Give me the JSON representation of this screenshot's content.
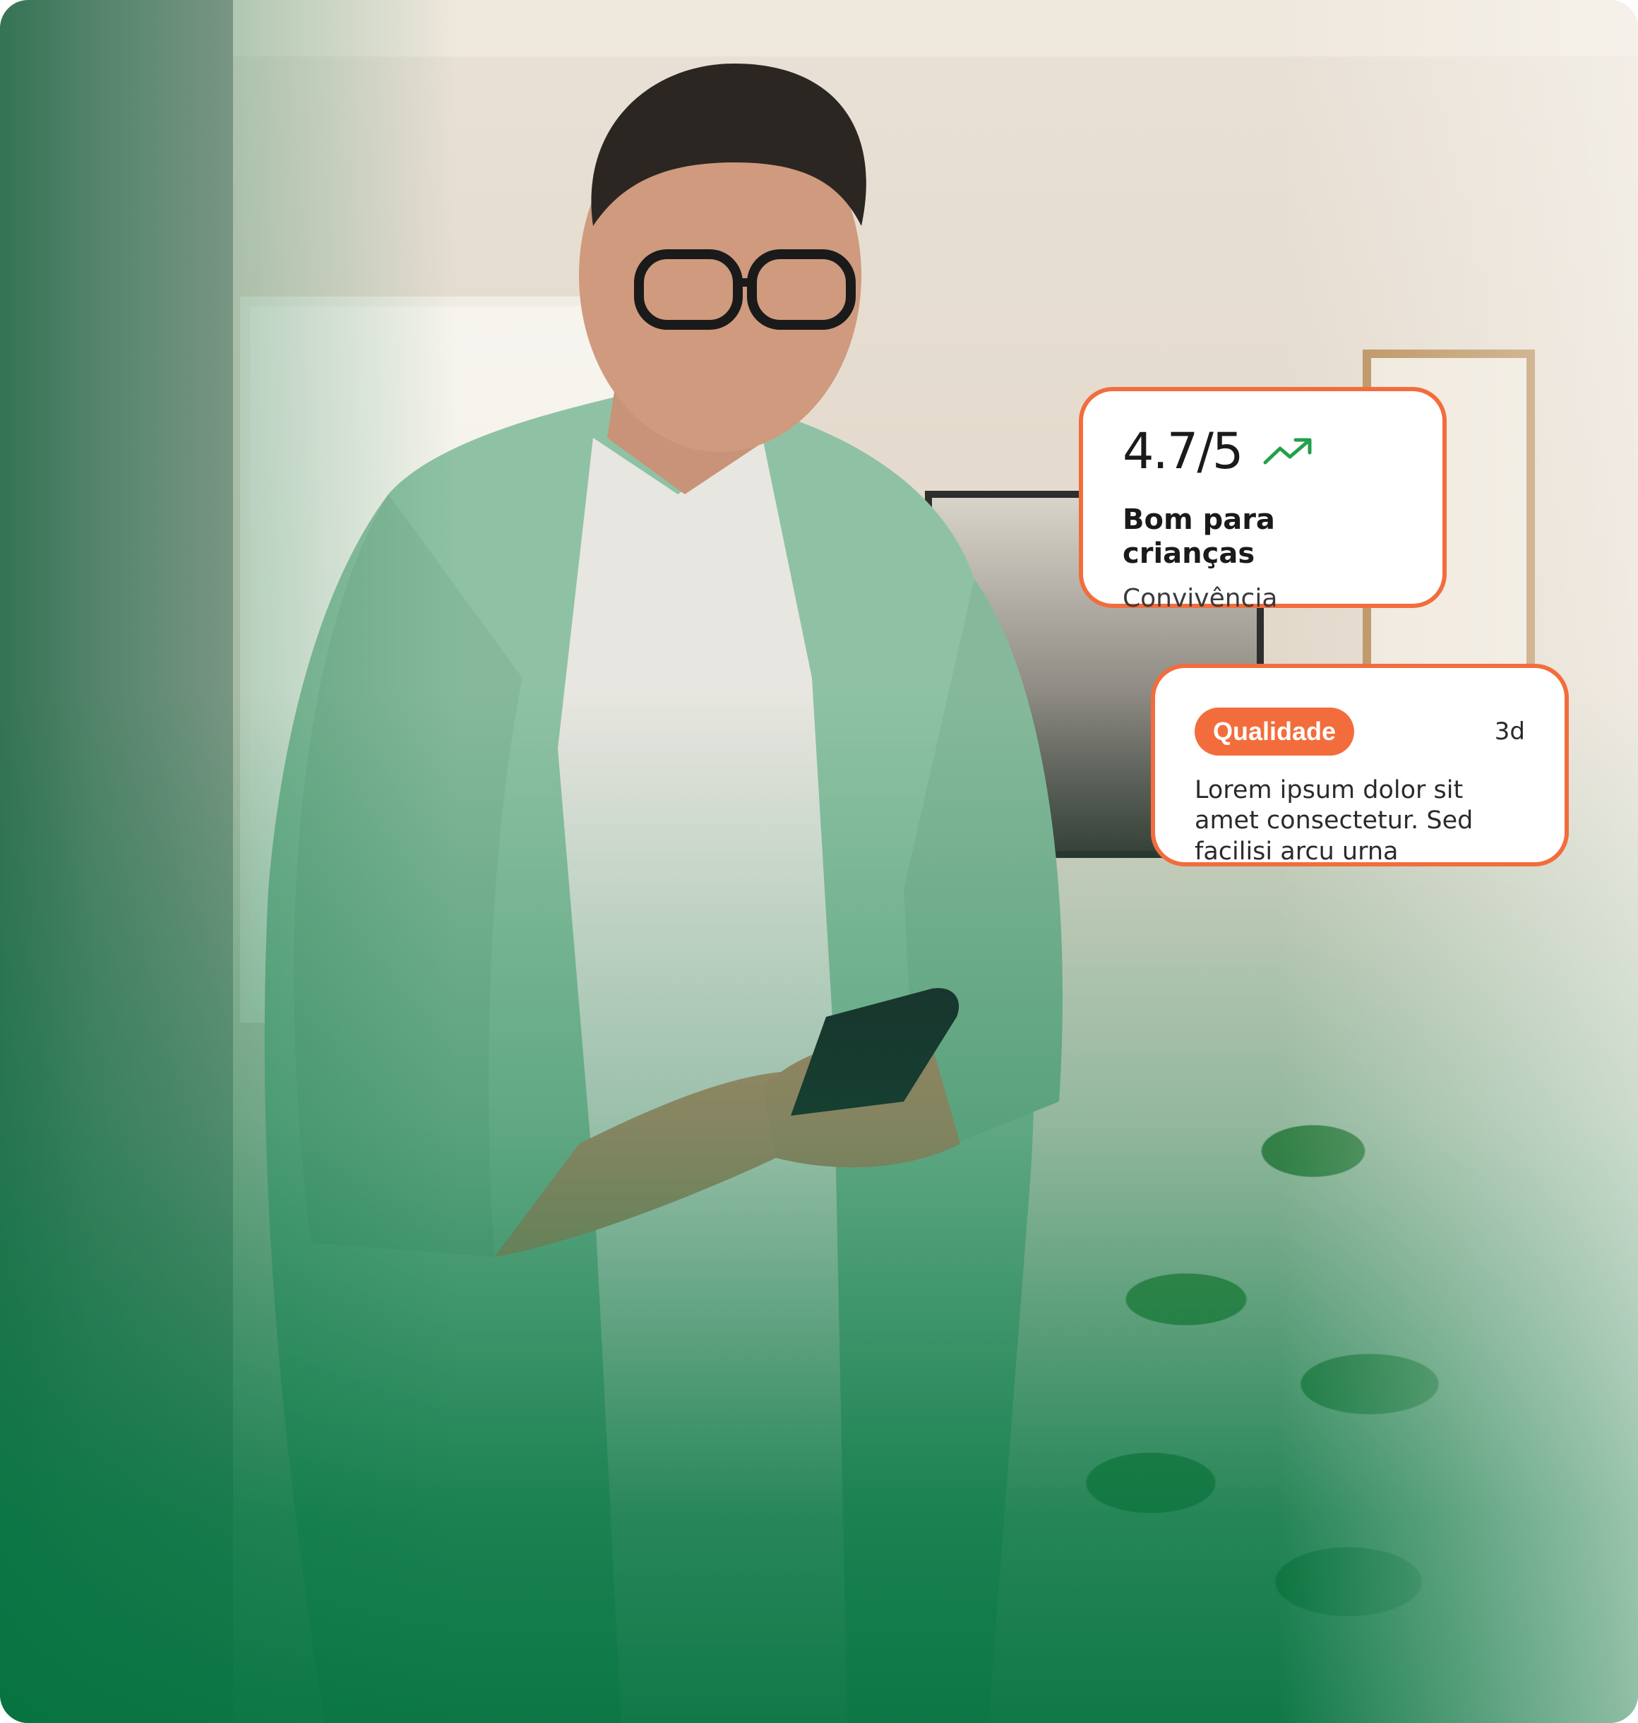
{
  "photo": {
    "subject_icon": "person-with-phone-photo",
    "accent_green": "#087845",
    "accent_orange": "#f26d3d"
  },
  "rating_card": {
    "value": "4.7/5",
    "trend_icon": "trending-up-icon",
    "trend_color": "#22a04a",
    "title": "Bom para crianças",
    "subtitle": "Convivência"
  },
  "review_card": {
    "tag": "Qualidade",
    "age": "3d",
    "text": "Lorem ipsum dolor sit amet consectetur. Sed facilisi arcu urna"
  }
}
